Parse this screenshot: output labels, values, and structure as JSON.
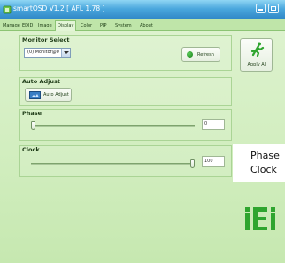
{
  "window": {
    "title": "smartOSD V1.2 [ AFL 1.78 ]"
  },
  "tabs": [
    {
      "label": "Manage"
    },
    {
      "label": "EDID"
    },
    {
      "label": "Image"
    },
    {
      "label": "Display"
    },
    {
      "label": "Color"
    },
    {
      "label": "PIP"
    },
    {
      "label": "System"
    },
    {
      "label": "About"
    }
  ],
  "active_tab": "Display",
  "monitor_select": {
    "label": "Monitor Select",
    "selected": "(0) Monitor@0"
  },
  "refresh_button": {
    "label": "Refresh"
  },
  "apply_button": {
    "label": "Apply All"
  },
  "auto_adjust": {
    "label": "Auto Adjust",
    "button_label": "Auto Adjust"
  },
  "phase": {
    "label": "Phase",
    "value": "0",
    "level": 0
  },
  "clock": {
    "label": "Clock",
    "value": "100",
    "level": 1
  },
  "callout": {
    "line1": "Phase",
    "line2": "Clock"
  },
  "colors": {
    "titlebar": "#3a96d4",
    "panel": "#d0edbd",
    "brand_green": "#2fa52f"
  },
  "logo": {
    "text": "iEi"
  }
}
